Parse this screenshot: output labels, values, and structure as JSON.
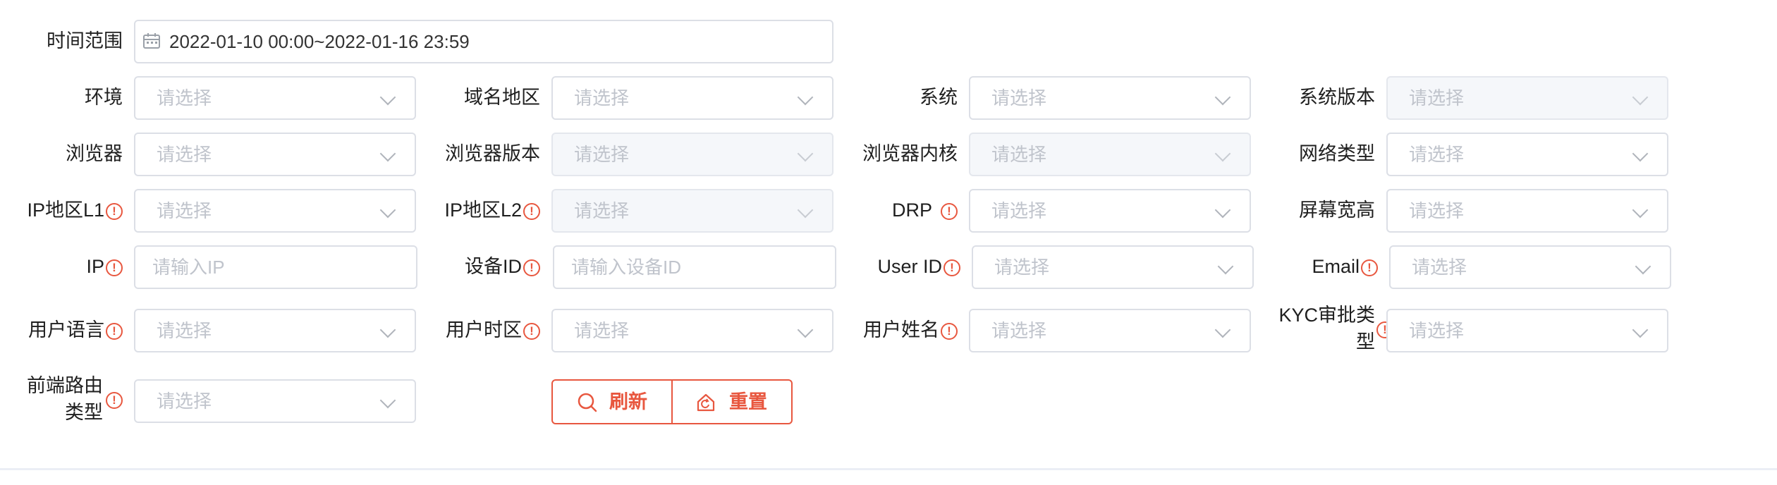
{
  "form": {
    "time_range": {
      "label": "时间范围",
      "value": "2022-01-10 00:00~2022-01-16 23:59"
    },
    "fields": {
      "env": {
        "label": "环境",
        "placeholder": "请选择"
      },
      "domain_region": {
        "label": "域名地区",
        "placeholder": "请选择"
      },
      "os": {
        "label": "系统",
        "placeholder": "请选择"
      },
      "os_version": {
        "label": "系统版本",
        "placeholder": "请选择"
      },
      "browser": {
        "label": "浏览器",
        "placeholder": "请选择"
      },
      "browser_version": {
        "label": "浏览器版本",
        "placeholder": "请选择"
      },
      "browser_engine": {
        "label": "浏览器内核",
        "placeholder": "请选择"
      },
      "network_type": {
        "label": "网络类型",
        "placeholder": "请选择"
      },
      "ip_region_l1": {
        "label": "IP地区L1",
        "placeholder": "请选择"
      },
      "ip_region_l2": {
        "label": "IP地区L2",
        "placeholder": "请选择"
      },
      "drp": {
        "label": "DRP",
        "placeholder": "请选择"
      },
      "screen_size": {
        "label": "屏幕宽高",
        "placeholder": "请选择"
      },
      "ip": {
        "label": "IP",
        "placeholder": "请输入IP"
      },
      "device_id": {
        "label": "设备ID",
        "placeholder": "请输入设备ID"
      },
      "user_id": {
        "label": "User ID",
        "placeholder": "请选择"
      },
      "email": {
        "label": "Email",
        "placeholder": "请选择"
      },
      "user_language": {
        "label": "用户语言",
        "placeholder": "请选择"
      },
      "user_timezone": {
        "label": "用户时区",
        "placeholder": "请选择"
      },
      "user_name": {
        "label": "用户姓名",
        "placeholder": "请选择"
      },
      "kyc_type": {
        "label": "KYC审批类型",
        "placeholder": "请选择"
      },
      "route_type": {
        "label": "前端路由类型",
        "placeholder": "请选择"
      }
    },
    "warn_symbol": "!",
    "buttons": {
      "refresh": "刷新",
      "reset": "重置"
    }
  },
  "colors": {
    "accent": "#e8573f",
    "placeholder": "#c0c4cc",
    "border": "#dcdfe6",
    "disabled_bg": "#f5f7fa"
  }
}
